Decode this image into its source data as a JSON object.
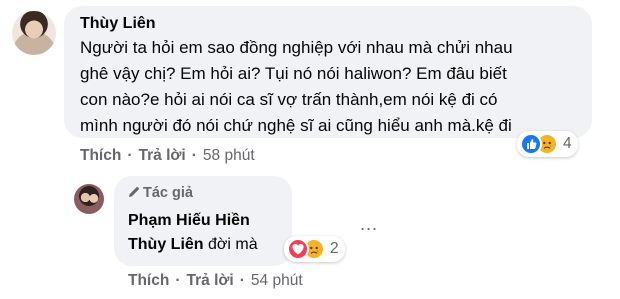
{
  "comment": {
    "author": "Thùy Liên",
    "lines": [
      "Người ta hỏi em sao đồng nghiệp với nhau mà chửi nhau",
      "ghê vậy chị? Em hỏi ai? Tụi nó nói haliwon? Em đâu biết",
      "con nào?e hỏi ai nói ca sĩ vợ trấn thành,em nói kệ đi có",
      "mình người đó nói chứ nghệ sĩ ai cũng hiểu anh mà.kệ đi"
    ],
    "like_label": "Thích",
    "reply_label": "Trả lời",
    "time": "58 phút",
    "reaction_count": "4"
  },
  "reply": {
    "badge": "Tác giả",
    "author": "Phạm Hiếu Hiền",
    "mention": "Thùy Liên",
    "text": "đời mà",
    "like_label": "Thích",
    "reply_label": "Trả lời",
    "time": "54 phút",
    "reaction_count": "2",
    "more": "..."
  },
  "colors": {
    "bubble": "#f0f2f5",
    "meta": "#65676b",
    "like": "#1877f2",
    "love": "#f33e58",
    "sad": "#f7b125"
  }
}
